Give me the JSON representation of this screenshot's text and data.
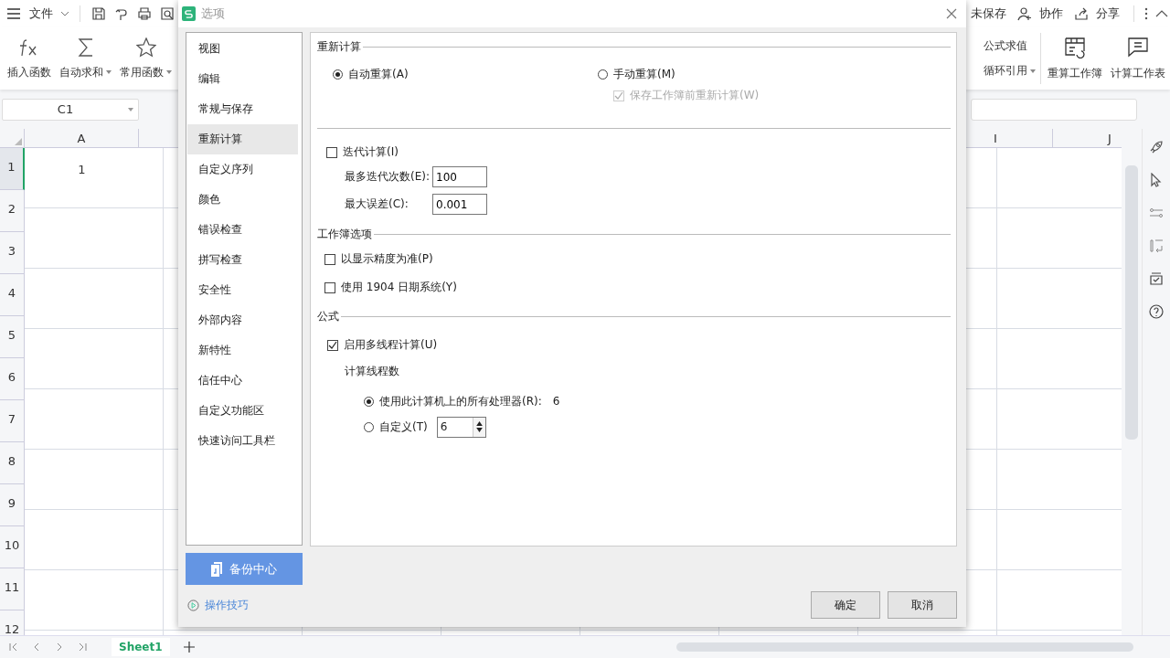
{
  "topbar": {
    "menu": "文件",
    "status": "未保存",
    "collab": "协作",
    "share": "分享"
  },
  "ribbon": {
    "left": [
      {
        "label": "插入函数",
        "dropdown": false
      },
      {
        "label": "自动求和",
        "dropdown": true
      },
      {
        "label": "常用函数",
        "dropdown": true
      }
    ],
    "small": [
      {
        "label": "公式求值",
        "dropdown": false
      },
      {
        "label": "循环引用",
        "dropdown": true
      }
    ],
    "right": [
      {
        "label": "重算工作簿"
      },
      {
        "label": "计算工作表"
      }
    ]
  },
  "name_box": "C1",
  "sheet": {
    "columns": [
      "A",
      "I",
      "J"
    ],
    "rows": [
      {
        "header": "1",
        "selected": true,
        "a": "1"
      },
      {
        "header": "2",
        "selected": false
      },
      {
        "header": "3",
        "selected": false
      },
      {
        "header": "4",
        "selected": false
      },
      {
        "header": "5",
        "selected": false
      },
      {
        "header": "6",
        "selected": false
      },
      {
        "header": "7",
        "selected": false
      },
      {
        "header": "8",
        "selected": false
      },
      {
        "header": "9",
        "selected": false
      },
      {
        "header": "10",
        "selected": false
      },
      {
        "header": "11",
        "selected": false
      },
      {
        "header": "12",
        "selected": false
      }
    ]
  },
  "sheet_tabs": [
    {
      "label": "Sheet1",
      "selected": true
    }
  ],
  "dialog": {
    "title": "选项",
    "nav": [
      {
        "label": "视图",
        "selected": false
      },
      {
        "label": "编辑",
        "selected": false
      },
      {
        "label": "常规与保存",
        "selected": false
      },
      {
        "label": "重新计算",
        "selected": true
      },
      {
        "label": "自定义序列",
        "selected": false
      },
      {
        "label": "颜色",
        "selected": false
      },
      {
        "label": "错误检查",
        "selected": false
      },
      {
        "label": "拼写检查",
        "selected": false
      },
      {
        "label": "安全性",
        "selected": false
      },
      {
        "label": "外部内容",
        "selected": false
      },
      {
        "label": "新特性",
        "selected": false
      },
      {
        "label": "信任中心",
        "selected": false
      },
      {
        "label": "自定义功能区",
        "selected": false
      },
      {
        "label": "快速访问工具栏",
        "selected": false
      }
    ],
    "backup_button": "备份中心",
    "tips_link": "操作技巧",
    "recalc": {
      "title": "重新计算",
      "options": [
        {
          "label": "自动重算(A)",
          "selected": true
        },
        {
          "label": "手动重算(M)",
          "selected": false
        }
      ],
      "save_recalc": {
        "label": "保存工作簿前重新计算(W)",
        "checked": true,
        "disabled": true
      }
    },
    "iteration": {
      "label": "迭代计算(I)",
      "checked": false,
      "fields": [
        {
          "label": "最多迭代次数(E):",
          "value": "100"
        },
        {
          "label": "最大误差(C):",
          "value": "0.001"
        }
      ]
    },
    "workbook": {
      "title": "工作簿选项",
      "options": [
        {
          "label": "以显示精度为准(P)",
          "checked": false
        },
        {
          "label": "使用 1904 日期系统(Y)",
          "checked": false
        }
      ]
    },
    "formula": {
      "title": "公式",
      "multithread": {
        "label": "启用多线程计算(U)",
        "checked": true
      },
      "threads_label": "计算线程数",
      "thread_options": [
        {
          "label": "使用此计算机上的所有处理器(R):",
          "value": "6",
          "kind": "text",
          "selected": true
        },
        {
          "label": "自定义(T)",
          "value": "6",
          "kind": "spinner",
          "selected": false
        }
      ]
    },
    "buttons": [
      "确定",
      "取消"
    ]
  }
}
